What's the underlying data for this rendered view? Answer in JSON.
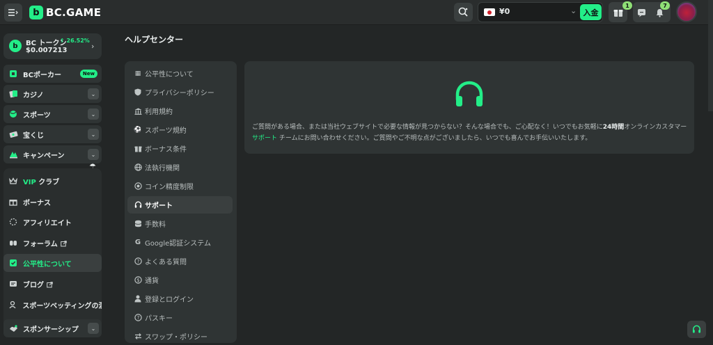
{
  "header": {
    "logo_text": "BC.GAME",
    "balance": "¥0",
    "deposit_label": "入金",
    "gift_count": "1",
    "notification_count": "7"
  },
  "sidebar": {
    "token": {
      "name": "BC トークン",
      "change": "26.52%",
      "price": "$0.007213"
    },
    "items": [
      {
        "label": "BCポーカー",
        "badge": "New"
      },
      {
        "label": "カジノ"
      },
      {
        "label": "スポーツ"
      },
      {
        "label": "宝くじ"
      },
      {
        "label": "キャンペーン"
      },
      {
        "label_accent": "VIP",
        "label": " クラブ"
      },
      {
        "label": "ボーナス"
      },
      {
        "label": "アフィリエイト"
      },
      {
        "label": "フォーラム"
      },
      {
        "label": "公平性について"
      },
      {
        "label": "ブログ"
      },
      {
        "label": "スポーツベッティングの洞"
      },
      {
        "label": "スポンサーシップ"
      }
    ]
  },
  "page": {
    "title": "ヘルプセンター",
    "nav": [
      "公平性について",
      "プライバシーポリシー",
      "利用規約",
      "スポーツ規約",
      "ボーナス条件",
      "法執行機関",
      "コイン精度制限",
      "サポート",
      "手数料",
      "Google認証システム",
      "よくある質問",
      "通貨",
      "登録とログイン",
      "パスキー",
      "スワップ・ポリシー"
    ],
    "support_text_before": "ご質問がある場合、または当社ウェブサイトで必要な情報が見つからない？そんな場合でも、ご心配なく！いつでもお気軽に",
    "support_text_24h": "24時間",
    "support_text_mid": "オンラインカスタマー ",
    "support_link": "サポート",
    "support_text_after": " チームにお問い合わせください。ご質問やご不明な点がございましたら、いつでも喜んでお手伝いいたします。"
  },
  "colors": {
    "accent": "#23ee88",
    "background": "#232626",
    "card": "#2f3434"
  }
}
